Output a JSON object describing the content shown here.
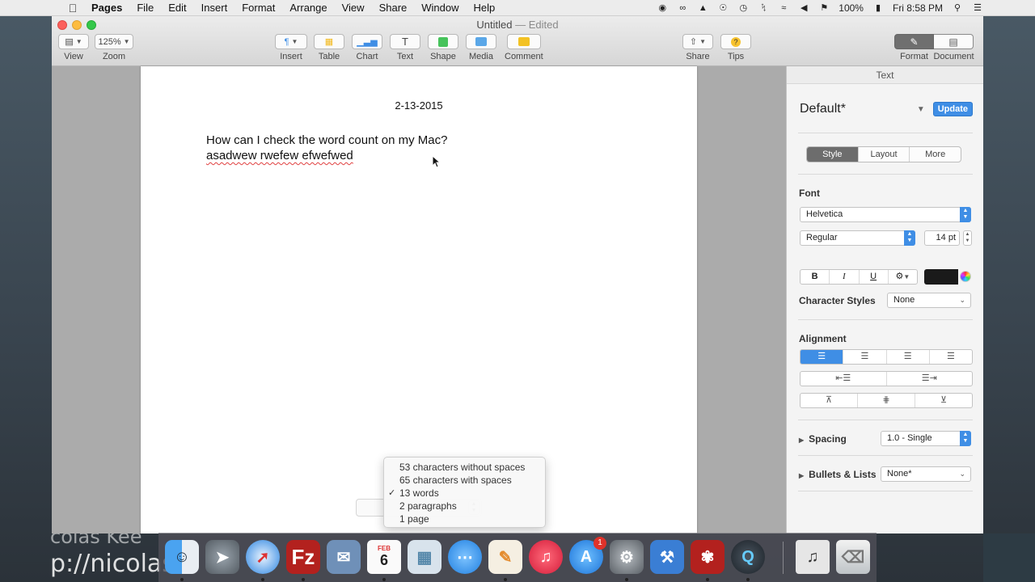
{
  "menubar": {
    "app": "Pages",
    "items": [
      "File",
      "Edit",
      "Insert",
      "Format",
      "Arrange",
      "View",
      "Share",
      "Window",
      "Help"
    ],
    "battery": "100%",
    "clock": "Fri 8:58 PM"
  },
  "window": {
    "title": "Untitled",
    "status": "— Edited"
  },
  "toolbar": {
    "view_label": "View",
    "zoom_value": "125%",
    "zoom_label": "Zoom",
    "insert_label": "Insert",
    "table_label": "Table",
    "chart_label": "Chart",
    "text_label": "Text",
    "shape_label": "Shape",
    "media_label": "Media",
    "comment_label": "Comment",
    "share_label": "Share",
    "tips_label": "Tips",
    "format_label": "Format",
    "document_label": "Document"
  },
  "document": {
    "date": "2-13-2015",
    "line1": "How can I check the word count on my Mac?",
    "line2": "asadwew rwefew efwefwed"
  },
  "word_count_menu": {
    "options": [
      "53 characters without spaces",
      "65 characters with spaces",
      "13 words",
      "2 paragraphs",
      "1 page"
    ],
    "checked_index": 2,
    "base_value": "13 words"
  },
  "inspector": {
    "header": "Text",
    "style_name": "Default*",
    "update_label": "Update",
    "tabs": [
      "Style",
      "Layout",
      "More"
    ],
    "font_label": "Font",
    "font_family": "Helvetica",
    "font_style": "Regular",
    "font_size": "14 pt",
    "bold": "B",
    "italic": "I",
    "underline": "U",
    "char_styles_label": "Character Styles",
    "char_styles_value": "None",
    "alignment_label": "Alignment",
    "spacing_label": "Spacing",
    "spacing_value": "1.0 - Single",
    "bullets_label": "Bullets & Lists",
    "bullets_value": "None*",
    "text_color": "#1a1a1a"
  },
  "watermark": {
    "line1": "colas Kee",
    "line2": "p://nicolas"
  },
  "dock": {
    "calendar_month": "FEB",
    "calendar_day": "6",
    "appstore_badge": "1"
  }
}
